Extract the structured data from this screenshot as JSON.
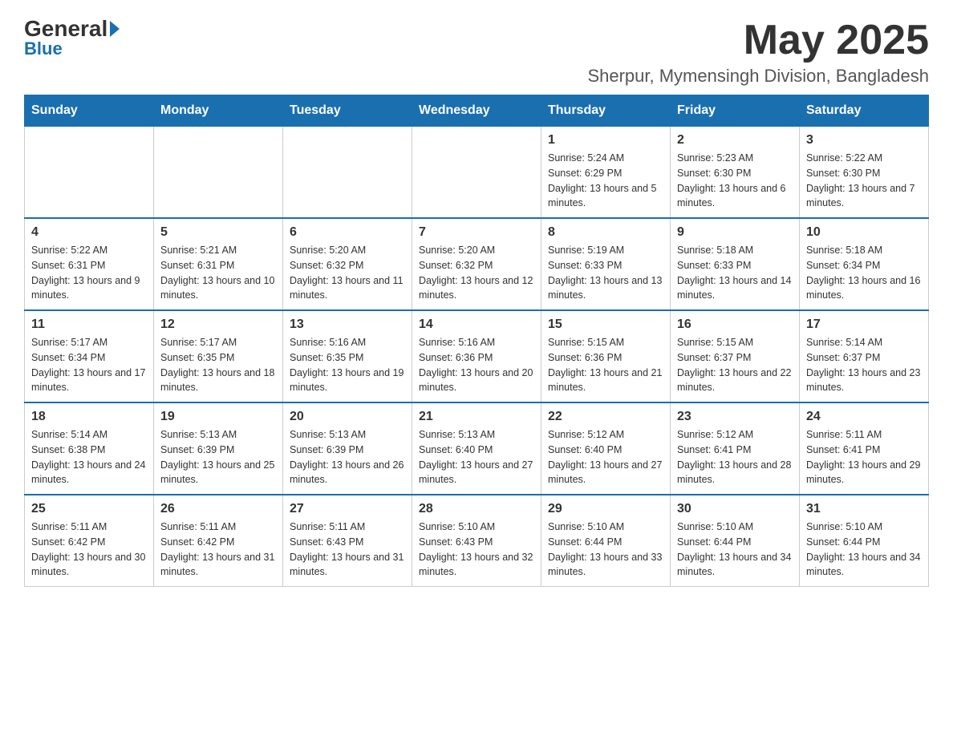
{
  "header": {
    "logo_general": "General",
    "logo_blue": "Blue",
    "month_year": "May 2025",
    "location": "Sherpur, Mymensingh Division, Bangladesh"
  },
  "days_of_week": [
    "Sunday",
    "Monday",
    "Tuesday",
    "Wednesday",
    "Thursday",
    "Friday",
    "Saturday"
  ],
  "weeks": [
    [
      {
        "day": "",
        "sunrise": "",
        "sunset": "",
        "daylight": ""
      },
      {
        "day": "",
        "sunrise": "",
        "sunset": "",
        "daylight": ""
      },
      {
        "day": "",
        "sunrise": "",
        "sunset": "",
        "daylight": ""
      },
      {
        "day": "",
        "sunrise": "",
        "sunset": "",
        "daylight": ""
      },
      {
        "day": "1",
        "sunrise": "Sunrise: 5:24 AM",
        "sunset": "Sunset: 6:29 PM",
        "daylight": "Daylight: 13 hours and 5 minutes."
      },
      {
        "day": "2",
        "sunrise": "Sunrise: 5:23 AM",
        "sunset": "Sunset: 6:30 PM",
        "daylight": "Daylight: 13 hours and 6 minutes."
      },
      {
        "day": "3",
        "sunrise": "Sunrise: 5:22 AM",
        "sunset": "Sunset: 6:30 PM",
        "daylight": "Daylight: 13 hours and 7 minutes."
      }
    ],
    [
      {
        "day": "4",
        "sunrise": "Sunrise: 5:22 AM",
        "sunset": "Sunset: 6:31 PM",
        "daylight": "Daylight: 13 hours and 9 minutes."
      },
      {
        "day": "5",
        "sunrise": "Sunrise: 5:21 AM",
        "sunset": "Sunset: 6:31 PM",
        "daylight": "Daylight: 13 hours and 10 minutes."
      },
      {
        "day": "6",
        "sunrise": "Sunrise: 5:20 AM",
        "sunset": "Sunset: 6:32 PM",
        "daylight": "Daylight: 13 hours and 11 minutes."
      },
      {
        "day": "7",
        "sunrise": "Sunrise: 5:20 AM",
        "sunset": "Sunset: 6:32 PM",
        "daylight": "Daylight: 13 hours and 12 minutes."
      },
      {
        "day": "8",
        "sunrise": "Sunrise: 5:19 AM",
        "sunset": "Sunset: 6:33 PM",
        "daylight": "Daylight: 13 hours and 13 minutes."
      },
      {
        "day": "9",
        "sunrise": "Sunrise: 5:18 AM",
        "sunset": "Sunset: 6:33 PM",
        "daylight": "Daylight: 13 hours and 14 minutes."
      },
      {
        "day": "10",
        "sunrise": "Sunrise: 5:18 AM",
        "sunset": "Sunset: 6:34 PM",
        "daylight": "Daylight: 13 hours and 16 minutes."
      }
    ],
    [
      {
        "day": "11",
        "sunrise": "Sunrise: 5:17 AM",
        "sunset": "Sunset: 6:34 PM",
        "daylight": "Daylight: 13 hours and 17 minutes."
      },
      {
        "day": "12",
        "sunrise": "Sunrise: 5:17 AM",
        "sunset": "Sunset: 6:35 PM",
        "daylight": "Daylight: 13 hours and 18 minutes."
      },
      {
        "day": "13",
        "sunrise": "Sunrise: 5:16 AM",
        "sunset": "Sunset: 6:35 PM",
        "daylight": "Daylight: 13 hours and 19 minutes."
      },
      {
        "day": "14",
        "sunrise": "Sunrise: 5:16 AM",
        "sunset": "Sunset: 6:36 PM",
        "daylight": "Daylight: 13 hours and 20 minutes."
      },
      {
        "day": "15",
        "sunrise": "Sunrise: 5:15 AM",
        "sunset": "Sunset: 6:36 PM",
        "daylight": "Daylight: 13 hours and 21 minutes."
      },
      {
        "day": "16",
        "sunrise": "Sunrise: 5:15 AM",
        "sunset": "Sunset: 6:37 PM",
        "daylight": "Daylight: 13 hours and 22 minutes."
      },
      {
        "day": "17",
        "sunrise": "Sunrise: 5:14 AM",
        "sunset": "Sunset: 6:37 PM",
        "daylight": "Daylight: 13 hours and 23 minutes."
      }
    ],
    [
      {
        "day": "18",
        "sunrise": "Sunrise: 5:14 AM",
        "sunset": "Sunset: 6:38 PM",
        "daylight": "Daylight: 13 hours and 24 minutes."
      },
      {
        "day": "19",
        "sunrise": "Sunrise: 5:13 AM",
        "sunset": "Sunset: 6:39 PM",
        "daylight": "Daylight: 13 hours and 25 minutes."
      },
      {
        "day": "20",
        "sunrise": "Sunrise: 5:13 AM",
        "sunset": "Sunset: 6:39 PM",
        "daylight": "Daylight: 13 hours and 26 minutes."
      },
      {
        "day": "21",
        "sunrise": "Sunrise: 5:13 AM",
        "sunset": "Sunset: 6:40 PM",
        "daylight": "Daylight: 13 hours and 27 minutes."
      },
      {
        "day": "22",
        "sunrise": "Sunrise: 5:12 AM",
        "sunset": "Sunset: 6:40 PM",
        "daylight": "Daylight: 13 hours and 27 minutes."
      },
      {
        "day": "23",
        "sunrise": "Sunrise: 5:12 AM",
        "sunset": "Sunset: 6:41 PM",
        "daylight": "Daylight: 13 hours and 28 minutes."
      },
      {
        "day": "24",
        "sunrise": "Sunrise: 5:11 AM",
        "sunset": "Sunset: 6:41 PM",
        "daylight": "Daylight: 13 hours and 29 minutes."
      }
    ],
    [
      {
        "day": "25",
        "sunrise": "Sunrise: 5:11 AM",
        "sunset": "Sunset: 6:42 PM",
        "daylight": "Daylight: 13 hours and 30 minutes."
      },
      {
        "day": "26",
        "sunrise": "Sunrise: 5:11 AM",
        "sunset": "Sunset: 6:42 PM",
        "daylight": "Daylight: 13 hours and 31 minutes."
      },
      {
        "day": "27",
        "sunrise": "Sunrise: 5:11 AM",
        "sunset": "Sunset: 6:43 PM",
        "daylight": "Daylight: 13 hours and 31 minutes."
      },
      {
        "day": "28",
        "sunrise": "Sunrise: 5:10 AM",
        "sunset": "Sunset: 6:43 PM",
        "daylight": "Daylight: 13 hours and 32 minutes."
      },
      {
        "day": "29",
        "sunrise": "Sunrise: 5:10 AM",
        "sunset": "Sunset: 6:44 PM",
        "daylight": "Daylight: 13 hours and 33 minutes."
      },
      {
        "day": "30",
        "sunrise": "Sunrise: 5:10 AM",
        "sunset": "Sunset: 6:44 PM",
        "daylight": "Daylight: 13 hours and 34 minutes."
      },
      {
        "day": "31",
        "sunrise": "Sunrise: 5:10 AM",
        "sunset": "Sunset: 6:44 PM",
        "daylight": "Daylight: 13 hours and 34 minutes."
      }
    ]
  ]
}
